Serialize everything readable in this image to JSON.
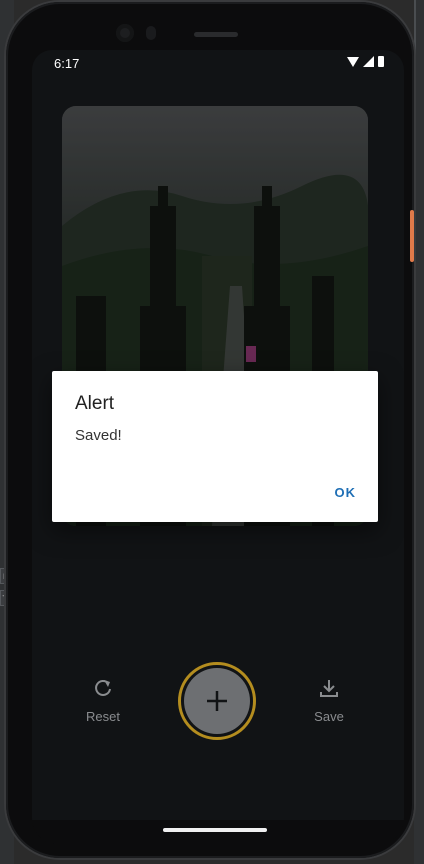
{
  "status_bar": {
    "time": "6:17"
  },
  "dialog": {
    "title": "Alert",
    "message": "Saved!",
    "ok_label": "OK"
  },
  "actions": {
    "reset_label": "Reset",
    "save_label": "Save",
    "reset_icon": "refresh-icon",
    "save_icon": "download-icon",
    "fab_icon": "plus-icon"
  },
  "left_panel_marks": [
    "r",
    "t"
  ],
  "colors": {
    "accent_ok": "#1f6fb5",
    "fab_ring": "#b48d1f",
    "screen_bg": "#111315"
  }
}
